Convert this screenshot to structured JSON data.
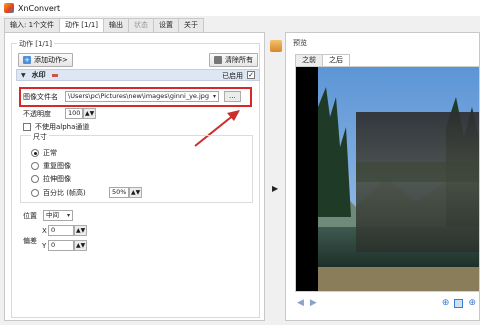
{
  "window": {
    "title": "XnConvert"
  },
  "tabs": [
    {
      "label": "输入: 1个文件"
    },
    {
      "label": "动作 [1/1]"
    },
    {
      "label": "输出"
    },
    {
      "label": "状态"
    },
    {
      "label": "设置"
    },
    {
      "label": "关于"
    }
  ],
  "actions_panel": {
    "group_title": "动作 [1/1]",
    "add_action_label": "添加动作>",
    "clear_all_label": "清除所有",
    "section": {
      "title": "水印",
      "enabled_label": "已启用",
      "enabled": true
    },
    "image_file": {
      "label": "图像文件名",
      "value": "\\Users\\pc\\Pictures\\new\\images\\ginni_ye.jpg",
      "browse_label": "..."
    },
    "opacity": {
      "label": "不透明度",
      "value": "100"
    },
    "alpha": {
      "label": "不使用alpha通道",
      "checked": false
    },
    "size": {
      "group_label": "尺寸",
      "options": [
        "正常",
        "重复图像",
        "拉伸图像",
        "百分比 (帧高)"
      ],
      "selected": "正常",
      "percent_value": "50%"
    },
    "position": {
      "label": "位置",
      "value": "中间"
    },
    "offset": {
      "label": "偏差",
      "x_label": "X",
      "x_value": "0",
      "y_label": "Y",
      "y_value": "0"
    }
  },
  "preview": {
    "title": "预览",
    "tabs": [
      {
        "label": "之前"
      },
      {
        "label": "之后"
      }
    ]
  },
  "colors": {
    "accent": "#3a7fd6",
    "highlight": "#d62a2a",
    "arrow": "#c9302c"
  }
}
